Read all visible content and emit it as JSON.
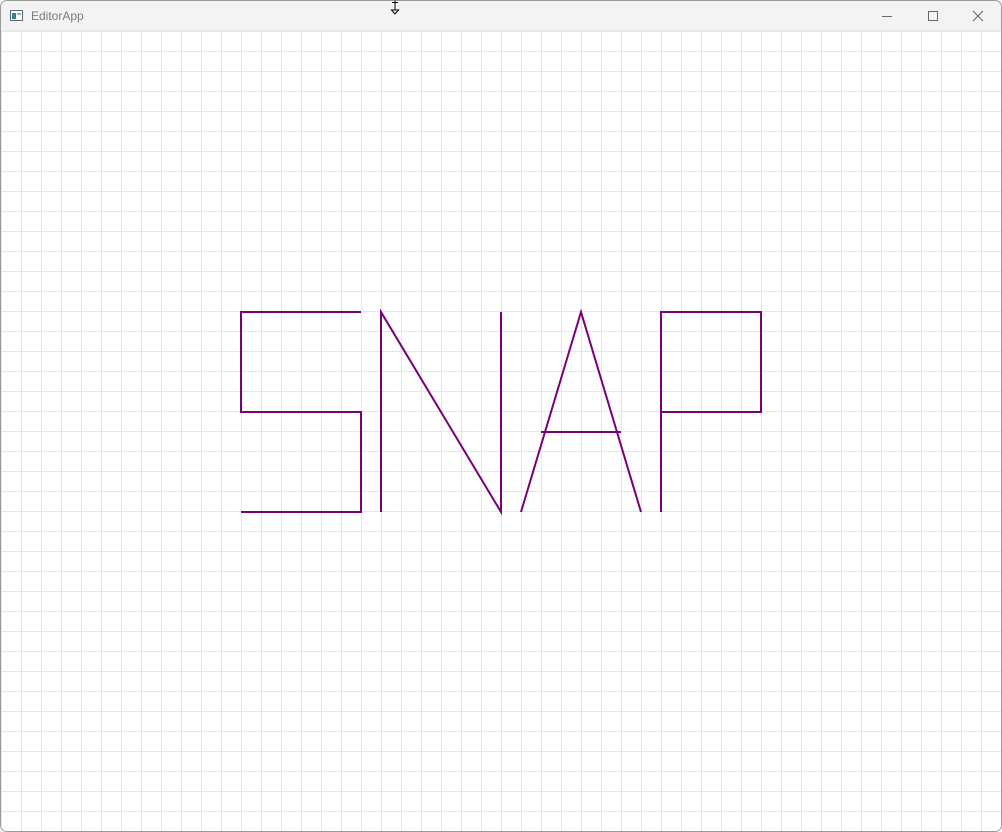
{
  "window": {
    "title": "EditorApp",
    "controls": {
      "minimize_icon": "minimize-icon",
      "maximize_icon": "maximize-icon",
      "close_icon": "close-icon"
    }
  },
  "canvas": {
    "background": "#ffffff",
    "grid_color": "#e6e6e6",
    "grid_spacing": 20,
    "stroke_color": "#780078",
    "drawn_text": "SNAP"
  },
  "cursor": {
    "icon": "resize-vertical-cursor-icon"
  }
}
